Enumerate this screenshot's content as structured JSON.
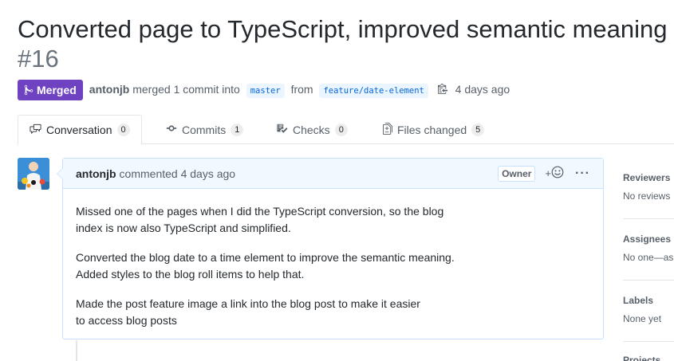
{
  "pr": {
    "title": "Converted page to TypeScript, improved semantic meaning",
    "number": "#16",
    "state": "Merged",
    "author": "antonjb",
    "merge_text": "merged 1 commit into",
    "base_branch": "master",
    "from_text": "from",
    "head_branch": "feature/date-element",
    "time": "4 days ago"
  },
  "tabs": [
    {
      "label": "Conversation",
      "count": "0",
      "icon": "comment-discussion-icon"
    },
    {
      "label": "Commits",
      "count": "1",
      "icon": "git-commit-icon"
    },
    {
      "label": "Checks",
      "count": "0",
      "icon": "checklist-icon"
    },
    {
      "label": "Files changed",
      "count": "5",
      "icon": "file-diff-icon"
    }
  ],
  "comment": {
    "author": "antonjb",
    "action": "commented",
    "time": "4 days ago",
    "role": "Owner",
    "reaction_label": "+",
    "more_label": "···",
    "paragraphs": [
      [
        "Missed one of the pages when I did the TypeScript conversion, so the blog",
        "index is now also TypeScript and simplified."
      ],
      [
        "Converted the blog date to a time element to improve the semantic meaning.",
        "Added styles to the blog roll items to help that."
      ],
      [
        "Made the post feature image a link into the blog post to make it easier",
        "to access blog posts"
      ]
    ]
  },
  "sidebar": {
    "reviewers": {
      "heading": "Reviewers",
      "value": "No reviews"
    },
    "assignees": {
      "heading": "Assignees",
      "value": "No one—as"
    },
    "labels": {
      "heading": "Labels",
      "value": "None yet"
    },
    "projects": {
      "heading": "Projects"
    }
  },
  "colors": {
    "merged": "#6f42c1",
    "link": "#0366d6",
    "comment_header_bg": "#f1f8ff",
    "comment_border": "#c8e1ff"
  }
}
